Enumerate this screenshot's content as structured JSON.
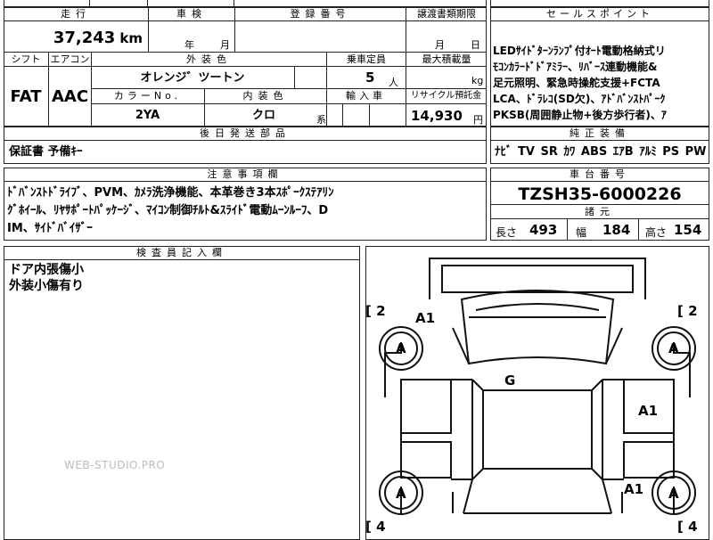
{
  "headers": {
    "mileage": "走行",
    "inspection": "車検",
    "registration": "登録番号",
    "transfer_deadline": "譲渡書類期限",
    "sales_point": "セールスポイント",
    "shift": "シフト",
    "aircon": "エアコン",
    "exterior_color": "外装色",
    "capacity": "乗車定員",
    "max_load": "最大積載量",
    "color_no": "カラーNo.",
    "interior_color": "内装色",
    "import": "輸入車",
    "recycle": "リサイクル預託金",
    "later_parts": "後日発送部品",
    "genuine_equipment": "純正装備",
    "notes": "注意事項欄",
    "chassis": "車台番号",
    "specs": "諸元",
    "inspector": "検査員記入欄"
  },
  "vehicle": {
    "mileage_value": "37,243",
    "mileage_unit": "km",
    "inspection_year": "年",
    "inspection_month": "月",
    "transfer_month": "月",
    "transfer_day": "日",
    "shift": "FAT",
    "aircon": "AAC",
    "exterior_color": "オレンジ゛ツートン",
    "capacity": "5",
    "capacity_unit": "人",
    "max_load_unit": "kg",
    "color_no": "2YA",
    "interior_color": "クロ",
    "interior_suffix": "系",
    "recycle_amount": "14,930",
    "recycle_unit": "円",
    "later_parts": "保証書 予備ｷｰ",
    "equipment": "ﾅﾋﾞ TV SR ｶﾜ ABS ｴｱB ｱﾙﾐ PS PW",
    "chassis_number": "TZSH35-6000226",
    "length_label": "長さ",
    "length": "493",
    "width_label": "幅",
    "width": "184",
    "height_label": "高さ",
    "height": "154"
  },
  "sales_point_lines": [
    "LEDｻｲﾄﾞﾀｰﾝﾗﾝﾌﾟ付ｵｰﾄ電動格納式リ",
    "ﾓｺﾝｶﾗｰﾄﾞﾄﾞｱﾐﾗｰ、ﾘﾊﾞｰｽ連動機能&",
    "足元照明、緊急時操舵支援+FCTA",
    "LCA、ﾄﾞﾗﾚｺ(SD欠)、ｱﾄﾞﾊﾞﾝｽﾄﾊﾟｰｸ",
    "PKSB(周囲静止物+後方歩行者)、ｱ"
  ],
  "notes_lines": [
    "ﾄﾞﾊﾞﾝｽﾄﾄﾞﾗｲﾌﾞ、PVM、ｶﾒﾗ洗浄機能、本革巻き3本ｽﾎﾟｰｸｽﾃｱﾘﾝ",
    "ｸﾞﾎｲｰﾙ、ﾘﾔｻﾎﾟｰﾄﾊﾟｯｹｰｼﾞ、ﾏｲｺﾝ制御ﾁﾙﾄ&ｽﾗｲﾄﾞ電動ﾑｰﾝﾙｰﾌ、D",
    "IM、ｻｲﾄﾞﾊﾞｲｻﾞｰ"
  ],
  "inspector_lines": [
    "ドア内張傷小",
    "外装小傷有り"
  ],
  "watermark": "WEB-STUDIO.PRO",
  "diagram": {
    "bracket_tl": "2",
    "bracket_tr": "2",
    "bracket_bl": "4",
    "bracket_br": "4",
    "tire_fl": "A",
    "tire_fr": "A",
    "tire_rl": "A",
    "tire_rr": "A",
    "mark_a1_front_left": "A1",
    "mark_g": "G",
    "mark_a1_right_door": "A1",
    "mark_a1_rear_right": "A1"
  }
}
